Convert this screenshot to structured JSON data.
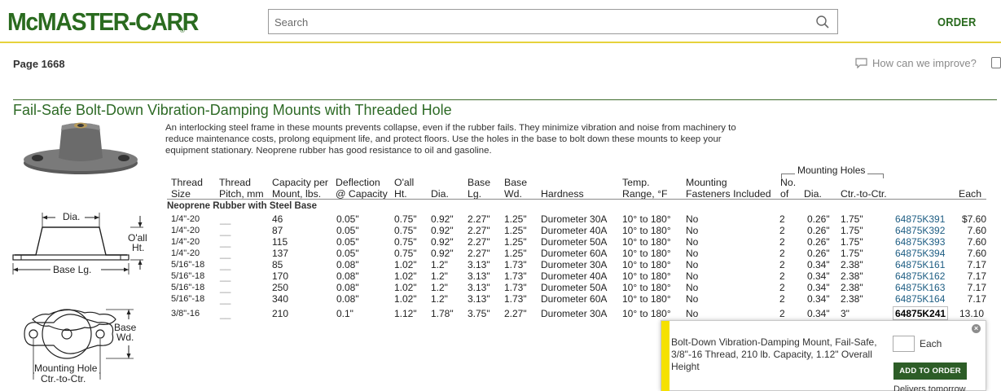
{
  "header": {
    "logo_text": "McMASTER-CARR",
    "logo_reg": "®",
    "search_placeholder": "Search",
    "order_label": "ORDER",
    "brand_color": "#2a6b1f",
    "rule_color": "#e6d23c"
  },
  "subheader": {
    "page_number": "Page 1668",
    "feedback_label": "How can we improve?"
  },
  "product": {
    "title": "Fail-Safe Bolt-Down Vibration-Damping Mounts with Threaded Hole",
    "description": "An interlocking steel frame in these mounts prevents collapse, even if the rubber fails. They minimize vibration and noise from machinery to reduce maintenance costs, prolong equipment life, and protect floors. Use the holes in the base to bolt down these mounts to keep your equipment stationary. Neoprene rubber has good resistance to oil and gasoline.",
    "drawing_labels": {
      "dia": "Dia.",
      "oall_1": "O'all",
      "oall_2": "Ht.",
      "base_lg": "Base Lg.",
      "base_wd_1": "Base",
      "base_wd_2": "Wd.",
      "mh_1": "Mounting Hole",
      "mh_2": "Ctr.-to-Ctr."
    }
  },
  "table": {
    "headers": {
      "thread_size_1": "Thread",
      "thread_size_2": "Size",
      "pitch_1": "Thread",
      "pitch_2": "Pitch, mm",
      "capacity_1": "Capacity per",
      "capacity_2": "Mount, lbs.",
      "deflection_1": "Deflection",
      "deflection_2": "@ Capacity",
      "oall_1": "O'all",
      "oall_2": "Ht.",
      "dia": "Dia.",
      "base_lg_1": "Base",
      "base_lg_2": "Lg.",
      "base_wd_1": "Base",
      "base_wd_2": "Wd.",
      "hardness": "Hardness",
      "temp_1": "Temp.",
      "temp_2": "Range, °F",
      "fasteners_1": "Mounting",
      "fasteners_2": "Fasteners Included",
      "no_1": "No.",
      "no_2": "of",
      "hole_dia": "Dia.",
      "ctc": "Ctr.-to-Ctr.",
      "each": "Each",
      "mounting_holes": "Mounting Holes"
    },
    "group_label": "Neoprene Rubber with Steel Base",
    "rows": [
      {
        "thread": "1/4\"-20",
        "pitch": "__",
        "capacity": "46",
        "deflection": "0.05\"",
        "oall": "0.75\"",
        "dia": "0.92\"",
        "base_lg": "2.27\"",
        "base_wd": "1.25\"",
        "hardness": "Durometer 30A",
        "temp": "10° to 180°",
        "fasteners": "No",
        "no_holes": "2",
        "hole_dia": "0.26\"",
        "ctc": "1.75\"",
        "part": "64875K391",
        "each": "$7.60"
      },
      {
        "thread": "1/4\"-20",
        "pitch": "__",
        "capacity": "87",
        "deflection": "0.05\"",
        "oall": "0.75\"",
        "dia": "0.92\"",
        "base_lg": "2.27\"",
        "base_wd": "1.25\"",
        "hardness": "Durometer 40A",
        "temp": "10° to 180°",
        "fasteners": "No",
        "no_holes": "2",
        "hole_dia": "0.26\"",
        "ctc": "1.75\"",
        "part": "64875K392",
        "each": "7.60"
      },
      {
        "thread": "1/4\"-20",
        "pitch": "__",
        "capacity": "115",
        "deflection": "0.05\"",
        "oall": "0.75\"",
        "dia": "0.92\"",
        "base_lg": "2.27\"",
        "base_wd": "1.25\"",
        "hardness": "Durometer 50A",
        "temp": "10° to 180°",
        "fasteners": "No",
        "no_holes": "2",
        "hole_dia": "0.26\"",
        "ctc": "1.75\"",
        "part": "64875K393",
        "each": "7.60"
      },
      {
        "thread": "1/4\"-20",
        "pitch": "__",
        "capacity": "137",
        "deflection": "0.05\"",
        "oall": "0.75\"",
        "dia": "0.92\"",
        "base_lg": "2.27\"",
        "base_wd": "1.25\"",
        "hardness": "Durometer 60A",
        "temp": "10° to 180°",
        "fasteners": "No",
        "no_holes": "2",
        "hole_dia": "0.26\"",
        "ctc": "1.75\"",
        "part": "64875K394",
        "each": "7.60"
      },
      {
        "thread": "5/16\"-18",
        "pitch": "__",
        "capacity": "85",
        "deflection": "0.08\"",
        "oall": "1.02\"",
        "dia": "1.2\"",
        "base_lg": "3.13\"",
        "base_wd": "1.73\"",
        "hardness": "Durometer 30A",
        "temp": "10° to 180°",
        "fasteners": "No",
        "no_holes": "2",
        "hole_dia": "0.34\"",
        "ctc": "2.38\"",
        "part": "64875K161",
        "each": "7.17"
      },
      {
        "thread": "5/16\"-18",
        "pitch": "__",
        "capacity": "170",
        "deflection": "0.08\"",
        "oall": "1.02\"",
        "dia": "1.2\"",
        "base_lg": "3.13\"",
        "base_wd": "1.73\"",
        "hardness": "Durometer 40A",
        "temp": "10° to 180°",
        "fasteners": "No",
        "no_holes": "2",
        "hole_dia": "0.34\"",
        "ctc": "2.38\"",
        "part": "64875K162",
        "each": "7.17"
      },
      {
        "thread": "5/16\"-18",
        "pitch": "__",
        "capacity": "250",
        "deflection": "0.08\"",
        "oall": "1.02\"",
        "dia": "1.2\"",
        "base_lg": "3.13\"",
        "base_wd": "1.73\"",
        "hardness": "Durometer 50A",
        "temp": "10° to 180°",
        "fasteners": "No",
        "no_holes": "2",
        "hole_dia": "0.34\"",
        "ctc": "2.38\"",
        "part": "64875K163",
        "each": "7.17"
      },
      {
        "thread": "5/16\"-18",
        "pitch": "__",
        "capacity": "340",
        "deflection": "0.08\"",
        "oall": "1.02\"",
        "dia": "1.2\"",
        "base_lg": "3.13\"",
        "base_wd": "1.73\"",
        "hardness": "Durometer 60A",
        "temp": "10° to 180°",
        "fasteners": "No",
        "no_holes": "2",
        "hole_dia": "0.34\"",
        "ctc": "2.38\"",
        "part": "64875K164",
        "each": "7.17"
      },
      {
        "thread": "3/8\"-16",
        "pitch": "__",
        "capacity": "210",
        "deflection": "0.1\"",
        "oall": "1.12\"",
        "dia": "1.78\"",
        "base_lg": "3.75\"",
        "base_wd": "2.27\"",
        "hardness": "Durometer 30A",
        "temp": "10° to 180°",
        "fasteners": "No",
        "no_holes": "2",
        "hole_dia": "0.34\"",
        "ctc": "3\"",
        "part": "64875K241",
        "each": "13.10"
      }
    ]
  },
  "popup": {
    "description": "Bolt-Down Vibration-Damping Mount, Fail-Safe, 3/8\"-16 Thread, 210 lb. Capacity, 1.12\" Overall Height",
    "qty_label": "Each",
    "add_button": "ADD TO ORDER",
    "delivers": "Delivers tomorrow",
    "close_icon": "close-icon",
    "accent_color": "#f5e100",
    "button_color": "#2d5d27"
  }
}
